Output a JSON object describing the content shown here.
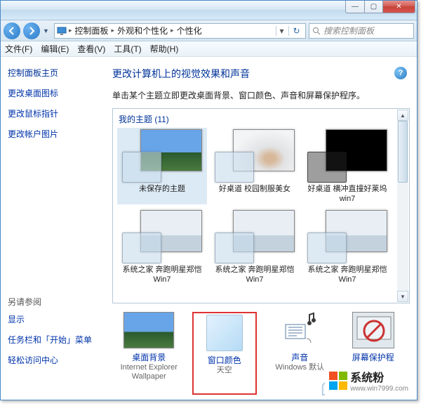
{
  "window": {
    "breadcrumb": [
      "控制面板",
      "外观和个性化",
      "个性化"
    ],
    "search_placeholder": "搜索控制面板"
  },
  "menu": {
    "file": "文件(F)",
    "edit": "编辑(E)",
    "view": "查看(V)",
    "tools": "工具(T)",
    "help": "帮助(H)"
  },
  "sidebar": {
    "home": "控制面板主页",
    "links": [
      "更改桌面图标",
      "更改鼠标指针",
      "更改帐户图片"
    ],
    "see_also": "另请参阅",
    "see_links": [
      "显示",
      "任务栏和「开始」菜单",
      "轻松访问中心"
    ]
  },
  "main": {
    "title": "更改计算机上的视觉效果和声音",
    "desc": "单击某个主题立即更改桌面背景、窗口颜色、声音和屏幕保护程序。",
    "my_themes_label": "我的主题 (11)",
    "themes": [
      {
        "label": "未保存的主题",
        "wp": "wp1",
        "glass": ""
      },
      {
        "label": "好桌道 校园制服美女",
        "wp": "wp2",
        "glass": ""
      },
      {
        "label": "好桌道 横冲直撞好莱坞win7",
        "wp": "wp3",
        "glass": "glass-dark"
      },
      {
        "label": "系统之家 奔跑明星郑恺Win7",
        "wp": "wp4",
        "glass": ""
      },
      {
        "label": "系统之家 奔跑明星郑恺Win7",
        "wp": "wp4",
        "glass": ""
      },
      {
        "label": "系统之家 奔跑明星郑恺Win7",
        "wp": "wp4",
        "glass": ""
      }
    ],
    "bottom": {
      "bg": {
        "l1": "桌面背景",
        "l2": "Internet Explorer Wallpaper"
      },
      "color": {
        "l1": "窗口颜色",
        "l2": "天空"
      },
      "sound": {
        "l1": "声音",
        "l2": "Windows 默认"
      },
      "saver": {
        "l1": "屏幕保护程",
        "l2": ""
      }
    }
  },
  "branding": {
    "name": "系统粉",
    "url": "www.win7999.com"
  }
}
